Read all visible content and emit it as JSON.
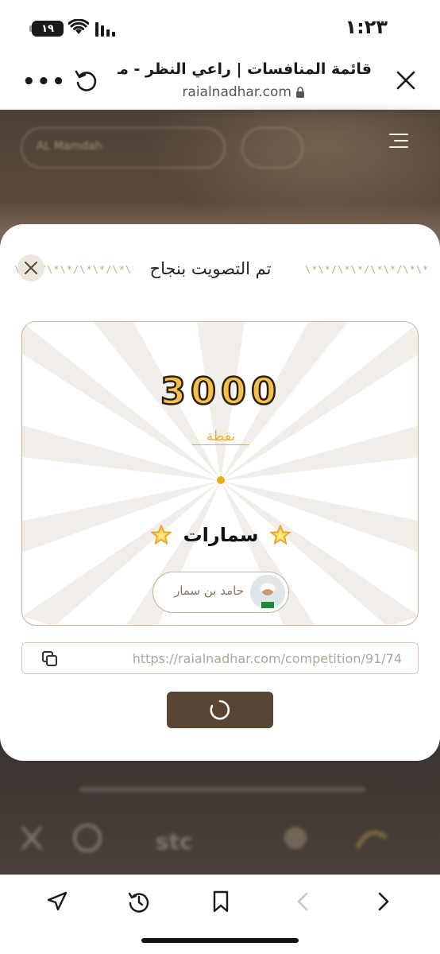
{
  "status_bar": {
    "time": "١:٢٣",
    "battery": "١٩"
  },
  "browser": {
    "page_title": "قائمة المنافسات | راعي النظر - منق...",
    "url": "raialnadhar.com"
  },
  "background_page": {
    "pill_text": "AL Mamdah"
  },
  "modal": {
    "title": "تم التصويت بنجاح",
    "points_value": "3000",
    "points_label": "نقطة",
    "team_name": "سمارات",
    "voter_name": "حامد بن سمار",
    "share_link": "https://raialnadhar.com/competition/91/74"
  },
  "toolbar": {
    "icons": [
      "share-icon",
      "history-icon",
      "bookmark-icon",
      "back-icon",
      "forward-icon"
    ]
  },
  "colors": {
    "accent_brown": "#5a4535",
    "points_gold": "#f5c04a",
    "label_gold": "#e5b13c",
    "border_beige": "#c7b29a"
  }
}
